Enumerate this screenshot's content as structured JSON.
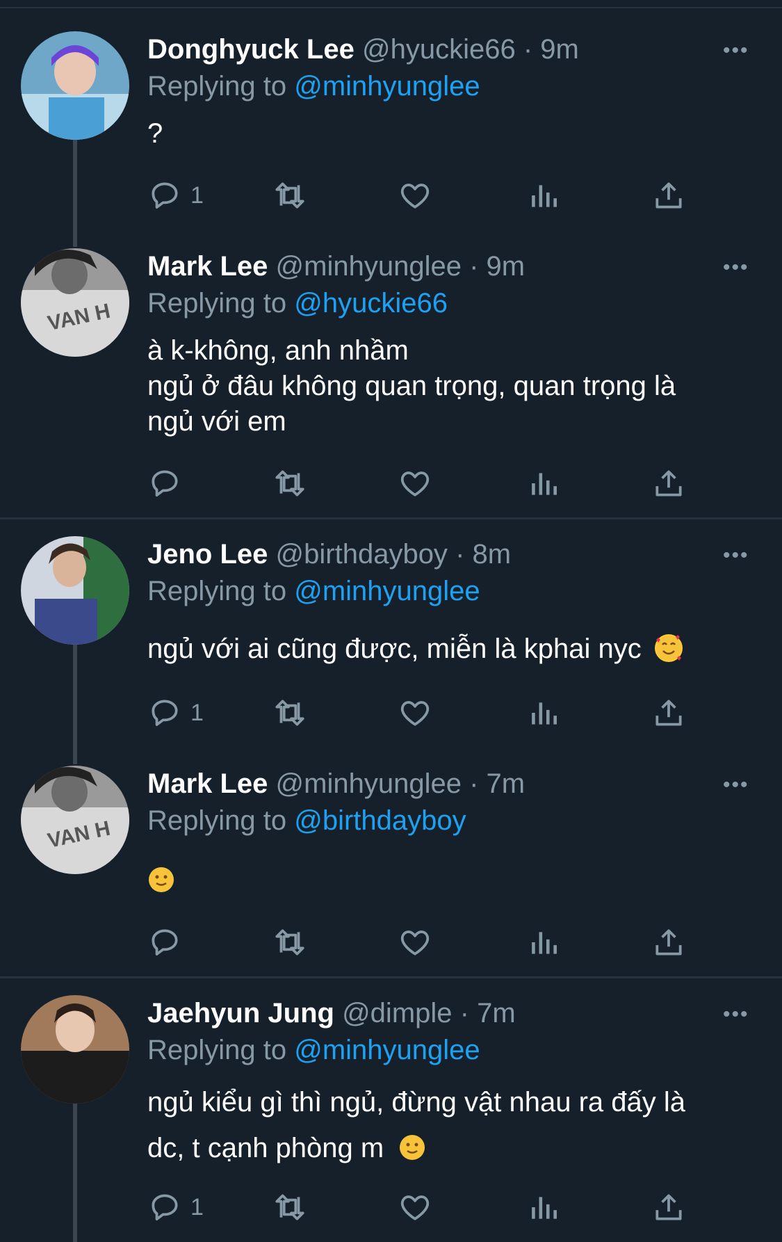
{
  "tweets": [
    {
      "name": "Donghyuck Lee",
      "handle": "@hyuckie66",
      "dot": "·",
      "time": "9m",
      "replying_prefix": "Replying to ",
      "replying_to": "@minhyunglee",
      "lines": [
        "?"
      ],
      "reply_count": "1",
      "more": "•••"
    },
    {
      "name": "Mark Lee",
      "handle": "@minhyunglee",
      "dot": "·",
      "time": "9m",
      "replying_prefix": "Replying to ",
      "replying_to": "@hyuckie66",
      "lines": [
        "à k-không, anh nhầm",
        "ngủ ở đâu không quan trọng, quan trọng là",
        "ngủ với em"
      ],
      "reply_count": "",
      "more": "•••"
    },
    {
      "name": "Jeno Lee",
      "handle": "@birthdayboy",
      "dot": "·",
      "time": "8m",
      "replying_prefix": "Replying to ",
      "replying_to": "@minhyunglee",
      "lines": [
        "ngủ với ai cũng được, miễn là kphai nyc"
      ],
      "reply_count": "1",
      "more": "•••"
    },
    {
      "name": "Mark Lee",
      "handle": "@minhyunglee",
      "dot": "·",
      "time": "7m",
      "replying_prefix": "Replying to ",
      "replying_to": "@birthdayboy",
      "lines": [
        ""
      ],
      "reply_count": "",
      "more": "•••"
    },
    {
      "name": "Jaehyun Jung",
      "handle": "@dimple",
      "dot": "·",
      "time": "7m",
      "replying_prefix": "Replying to ",
      "replying_to": "@minhyunglee",
      "lines": [
        "ngủ kiểu gì thì ngủ, đừng vật nhau ra đấy là",
        "dc, t cạnh phòng m"
      ],
      "reply_count": "1",
      "more": "•••"
    }
  ],
  "icons": {
    "reply": "reply-icon",
    "retweet": "retweet-icon",
    "like": "like-icon",
    "analytics": "analytics-icon",
    "share": "share-icon",
    "emoji_smiling_hearts": "smiling-face-with-hearts-emoji",
    "emoji_slight_smile": "slightly-smiling-face-emoji"
  },
  "colors": {
    "background": "#15202b",
    "secondary_text": "#8899a6",
    "mention": "#1da1f2",
    "divider": "#26333f"
  }
}
